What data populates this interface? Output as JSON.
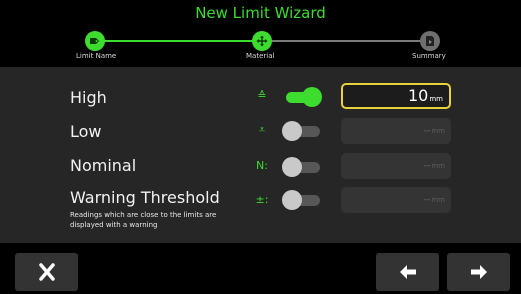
{
  "wizard": {
    "title": "New Limit Wizard",
    "steps": [
      {
        "label": "Limit Name",
        "icon": "tag-icon",
        "state": "active"
      },
      {
        "label": "Material",
        "icon": "move-arrows-icon",
        "state": "active"
      },
      {
        "label": "Summary",
        "icon": "summary-icon",
        "state": "inactive"
      }
    ]
  },
  "limits": {
    "rows": [
      {
        "label": "High",
        "icon_glyph": "≙",
        "icon_name": "upper-limit-icon",
        "enabled": true,
        "value": "10",
        "unit": "mm"
      },
      {
        "label": "Low",
        "icon_glyph": "⩡",
        "icon_name": "lower-limit-icon",
        "enabled": false,
        "value": "--",
        "unit": "mm"
      },
      {
        "label": "Nominal",
        "icon_glyph": "N:",
        "icon_name": "nominal-icon",
        "enabled": false,
        "value": "--",
        "unit": "mm"
      },
      {
        "label": "Warning Threshold",
        "sub": "Readings which are close to the limits are displayed with a warning",
        "icon_glyph": "±:",
        "icon_name": "plus-minus-icon",
        "enabled": false,
        "value": "--",
        "unit": "mm"
      }
    ]
  },
  "colors": {
    "accent": "#3ddc2e",
    "focus_border": "#e8d13a",
    "panel_bg": "#262626",
    "header_bg": "#000000"
  },
  "footer": {
    "cancel_icon": "close-icon",
    "back_icon": "arrow-left-icon",
    "next_icon": "arrow-right-icon"
  }
}
